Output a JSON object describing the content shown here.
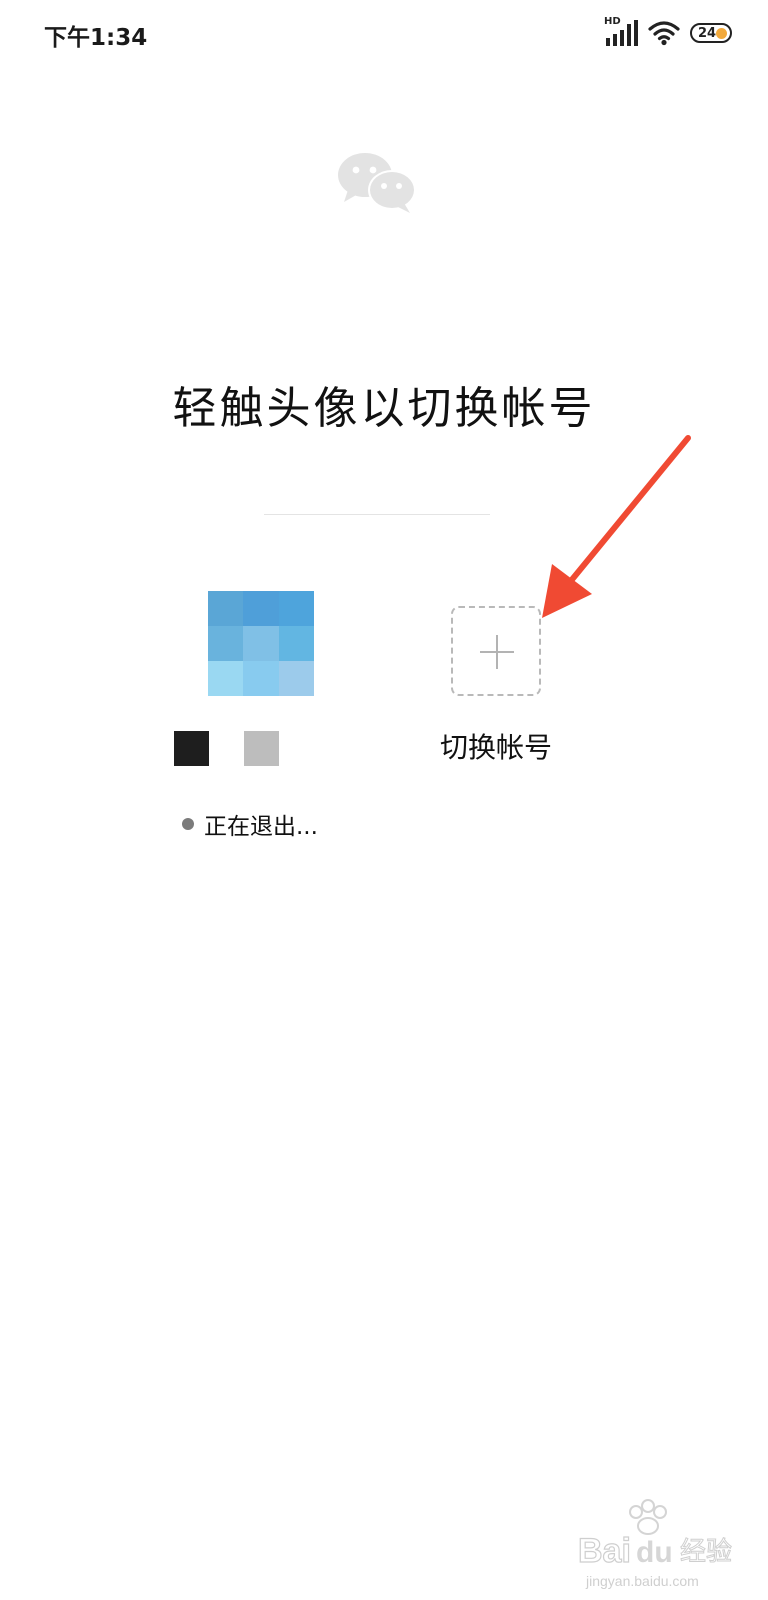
{
  "status_bar": {
    "time": "下午1:34",
    "network_label": "HD",
    "battery_level": "24",
    "icons": [
      "hd-signal-icon",
      "wifi-icon",
      "battery-icon"
    ]
  },
  "logo": {
    "icon": "wechat-logo-icon",
    "color": "#e3e3e3"
  },
  "page": {
    "title": "轻触头像以切换帐号"
  },
  "current_account": {
    "avatar_icon": "pixelated-avatar",
    "avatar_colors": [
      "#5aa6d6",
      "#4f9fd9",
      "#4ea4dc",
      "#69b3dd",
      "#80c0e6",
      "#62b6e2",
      "#9ad8f2",
      "#88cbef",
      "#9ccbeb"
    ],
    "name_block_colors": [
      "#1e1e1e",
      "#bdbdbd"
    ],
    "status_text": "正在退出..."
  },
  "add_account": {
    "icon": "plus-icon",
    "label": "切换帐号"
  },
  "annotation": {
    "icon": "red-arrow-icon",
    "color": "#f04a33"
  },
  "watermark": {
    "brand": "Bai",
    "brand_suffix": "du",
    "cn_text": "经验",
    "url": "jingyan.baidu.com"
  }
}
